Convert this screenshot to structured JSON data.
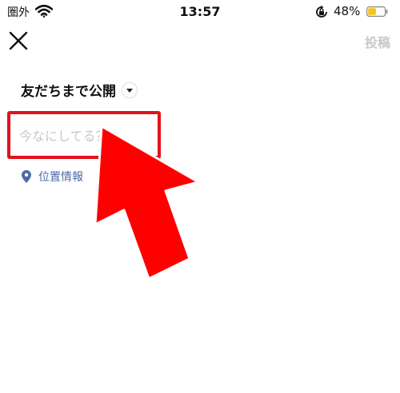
{
  "status_bar": {
    "carrier": "圏外",
    "time": "13:57",
    "battery_percent": "48%",
    "battery_level": 0.48,
    "wifi_icon": "wifi-icon",
    "rotation_lock_icon": "rotation-lock-icon"
  },
  "header": {
    "close_icon": "close-icon",
    "post_label": "投稿"
  },
  "audience": {
    "label": "友だちまで公開"
  },
  "composer": {
    "placeholder": "今なにしてる？"
  },
  "location": {
    "label": "位置情報",
    "icon": "location-pin-icon"
  },
  "colors": {
    "highlight": "#e3121b",
    "link": "#4e6aa6",
    "disabled": "#c8c8c8",
    "battery": "#f5c518"
  }
}
